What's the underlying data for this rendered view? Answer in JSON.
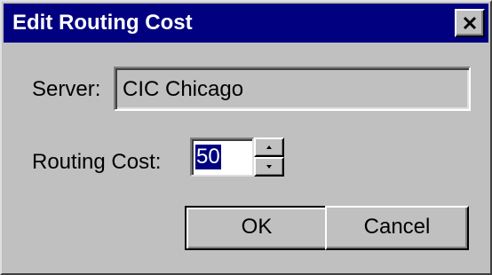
{
  "window": {
    "title": "Edit Routing Cost",
    "close_icon": "close-x-icon"
  },
  "server": {
    "label": "Server:",
    "value": "CIC Chicago",
    "readonly": true
  },
  "routing_cost": {
    "label": "Routing Cost:",
    "value": "50",
    "selected": true,
    "spin_up_icon": "arrow-up-icon",
    "spin_down_icon": "arrow-down-icon"
  },
  "buttons": {
    "ok_label": "OK",
    "cancel_label": "Cancel",
    "default": "ok"
  },
  "colors": {
    "dialog_face": "#c0c0c0",
    "titlebar": "#000080",
    "title_text": "#ffffff",
    "selection": "#000080"
  }
}
